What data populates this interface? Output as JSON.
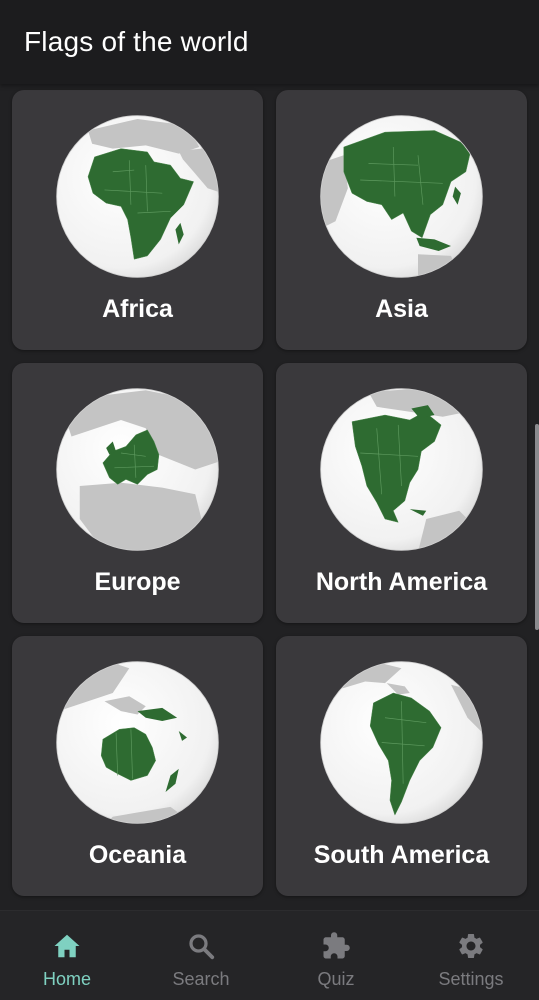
{
  "app_bar": {
    "title": "Flags of the world"
  },
  "continents": [
    {
      "label": "Africa",
      "globe_icon": "africa-globe"
    },
    {
      "label": "Asia",
      "globe_icon": "asia-globe"
    },
    {
      "label": "Europe",
      "globe_icon": "europe-globe"
    },
    {
      "label": "North America",
      "globe_icon": "north-america-globe"
    },
    {
      "label": "Oceania",
      "globe_icon": "oceania-globe"
    },
    {
      "label": "South America",
      "globe_icon": "south-america-globe"
    }
  ],
  "bottom_nav": {
    "items": [
      {
        "label": "Home",
        "icon": "home-icon",
        "active": true
      },
      {
        "label": "Search",
        "icon": "search-icon",
        "active": false
      },
      {
        "label": "Quiz",
        "icon": "puzzle-icon",
        "active": false
      },
      {
        "label": "Settings",
        "icon": "gear-icon",
        "active": false
      }
    ]
  },
  "colors": {
    "background": "#212123",
    "card": "#3a393c",
    "accent_active": "#7fd1c1",
    "nav_inactive": "#7b7b7f",
    "continent_green": "#2e6b31",
    "globe_sea": "#f5f5f5",
    "globe_land": "#bdbdbd"
  }
}
